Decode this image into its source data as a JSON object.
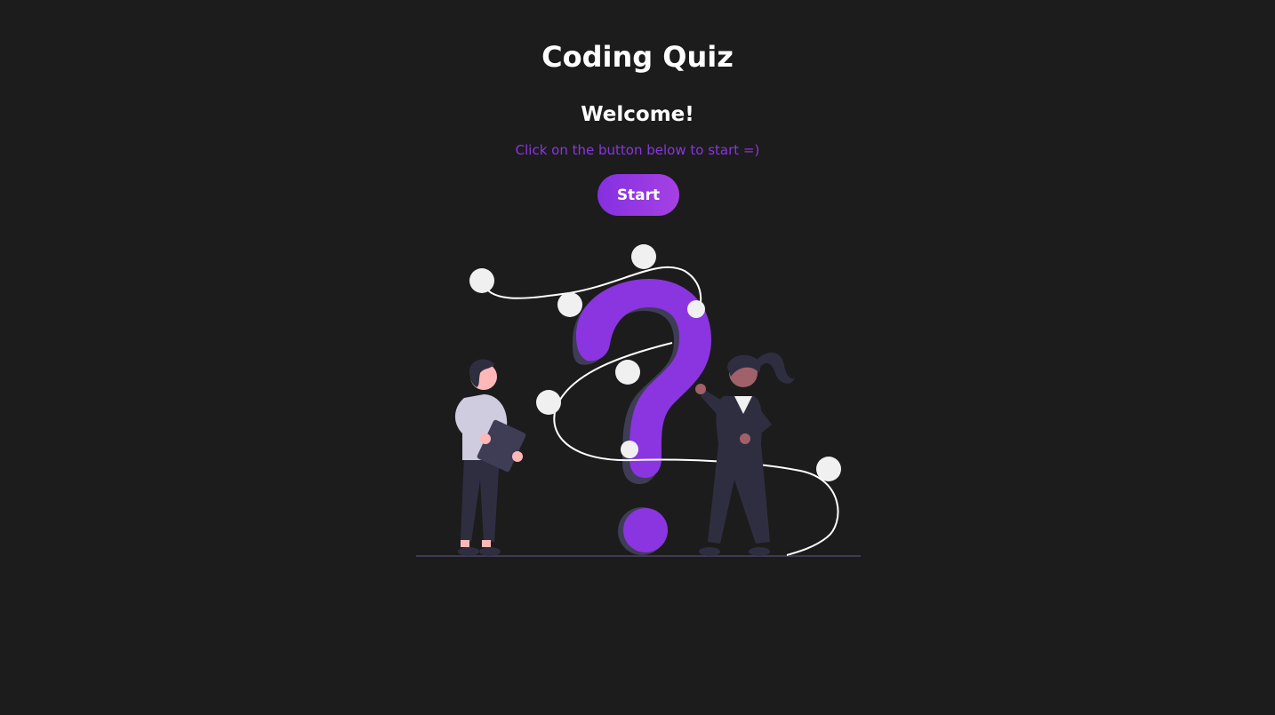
{
  "header": {
    "title": "Coding Quiz"
  },
  "intro": {
    "heading": "Welcome!",
    "instruction": "Click on the button below to start =)",
    "start_label": "Start"
  },
  "theme": {
    "background": "#1c1c1c",
    "accent": "#8a35e0",
    "accent_gradient_end": "#a541e4",
    "text": "#ffffff"
  },
  "illustration": {
    "name": "question-mark-people-illustration"
  }
}
